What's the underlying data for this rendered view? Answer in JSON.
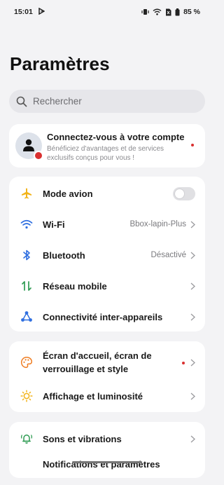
{
  "status_bar": {
    "time": "15:01",
    "battery": "85 %"
  },
  "page": {
    "title": "Paramètres"
  },
  "search": {
    "placeholder": "Rechercher"
  },
  "account": {
    "title": "Connectez-vous à votre compte",
    "subtitle": "Bénéficiez d'avantages et de services exclusifs conçus pour vous !"
  },
  "group1": {
    "airplane_label": "Mode avion",
    "airplane_on": false,
    "wifi_label": "Wi-Fi",
    "wifi_value": "Bbox-lapin-Plus",
    "bluetooth_label": "Bluetooth",
    "bluetooth_value": "Désactivé",
    "mobile_label": "Réseau mobile",
    "connectivity_label": "Connectivité inter-appareils"
  },
  "group2": {
    "home_label_line1": "Écran d'accueil, écran de",
    "home_label_line2": "verrouillage et style",
    "display_label": "Affichage et luminosité"
  },
  "group3": {
    "sound_label": "Sons et vibrations",
    "notif_label": "Notifications et paramètres"
  },
  "colors": {
    "background": "#f3f3f5",
    "card": "#ffffff",
    "accent_blue": "#2f6fe0",
    "airplane_yellow": "#f2b318",
    "mobile_green": "#2e9b52",
    "orange": "#ef7d22",
    "badge_red": "#d93030"
  }
}
